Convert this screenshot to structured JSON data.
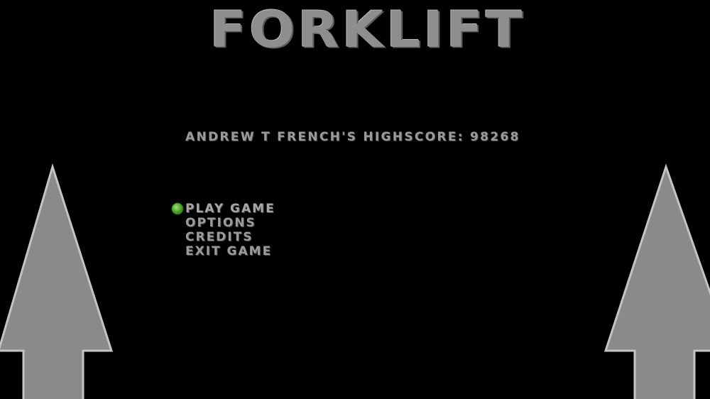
{
  "game": {
    "title": "FORKLIFT",
    "highscore_text": "ANDREW T FRENCH'S HIGHSCORE: 98268"
  },
  "menu": {
    "items": [
      {
        "label": "PLAY GAME",
        "selected": true
      },
      {
        "label": "OPTIONS",
        "selected": false
      },
      {
        "label": "CREDITS",
        "selected": false
      },
      {
        "label": "EXIT GAME",
        "selected": false
      }
    ]
  },
  "icons": {
    "selector": "green-orb-icon",
    "left_decoration": "up-arrow-icon",
    "right_decoration": "up-arrow-icon"
  },
  "colors": {
    "background": "#000000",
    "text": "#9a9a9a",
    "arrow_fill": "#8a8a8a",
    "arrow_outline": "#c4c4c4",
    "selector": "#4fa52c"
  }
}
